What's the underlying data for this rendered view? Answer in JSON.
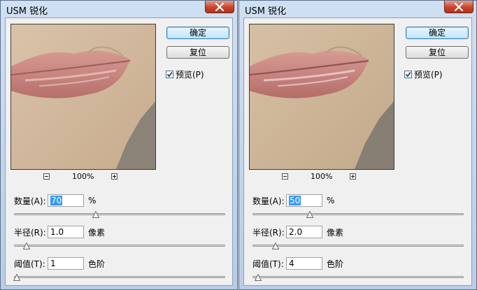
{
  "dialogs": [
    {
      "title": "USM 锐化",
      "ok_label": "确定",
      "reset_label": "复位",
      "preview_label": "预览(P)",
      "preview_checked": true,
      "zoom": "100%",
      "amount": {
        "label": "数量(A):",
        "value": "70",
        "unit": "%",
        "fraction": 0.376
      },
      "radius": {
        "label": "半径(R):",
        "value": "1.0",
        "unit": "像素",
        "fraction": 0.05
      },
      "threshold": {
        "label": "阈值(T):",
        "value": "1",
        "unit": "色阶",
        "fraction": 0.004
      }
    },
    {
      "title": "USM 锐化",
      "ok_label": "确定",
      "reset_label": "复位",
      "preview_label": "预览(P)",
      "preview_checked": true,
      "zoom": "100%",
      "amount": {
        "label": "数量(A):",
        "value": "50",
        "unit": "%",
        "fraction": 0.26
      },
      "radius": {
        "label": "半径(R):",
        "value": "2.0",
        "unit": "像素",
        "fraction": 0.1
      },
      "threshold": {
        "label": "阈值(T):",
        "value": "4",
        "unit": "色阶",
        "fraction": 0.016
      }
    }
  ],
  "colors": {
    "title_gradient_top": "#cfe0f3",
    "client_bg": "#f0f0f0",
    "close_button": "#c8442b",
    "selection": "#3399ff",
    "default_button_border": "#3c7fb1"
  },
  "icons": [
    "close-icon",
    "zoom-out-icon",
    "zoom-in-icon",
    "check-icon",
    "slider-thumb-icon"
  ]
}
